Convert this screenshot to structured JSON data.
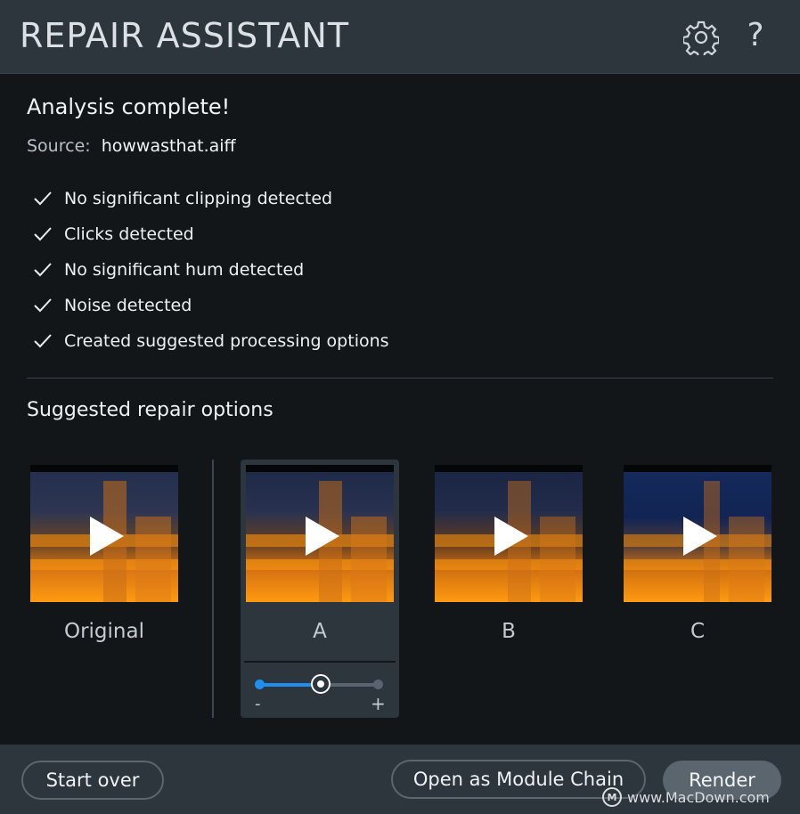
{
  "header": {
    "title": "REPAIR ASSISTANT",
    "settings_icon": "gear-icon",
    "help_icon": "help-icon",
    "help_glyph": "?"
  },
  "analysis": {
    "title": "Analysis complete!",
    "source_label": "Source:",
    "source_value": "howwasthat.aiff",
    "results": [
      "No significant clipping detected",
      "Clicks detected",
      "No significant hum detected",
      "Noise detected",
      "Created suggested processing options"
    ]
  },
  "repair": {
    "section_title": "Suggested repair options",
    "options": [
      {
        "label": "Original"
      },
      {
        "label": "A"
      },
      {
        "label": "B"
      },
      {
        "label": "C"
      }
    ],
    "selected": "A",
    "strength_slider": {
      "value": 0.52,
      "min_label": "-",
      "max_label": "+"
    }
  },
  "footer": {
    "start_over": "Start over",
    "open_module_chain": "Open as Module Chain",
    "render": "Render"
  },
  "watermark": {
    "logo_letter": "M",
    "text": "www.MacDown.com"
  },
  "colors": {
    "accent": "#1f8ef0",
    "panel": "#2d353d",
    "background": "#121619"
  }
}
